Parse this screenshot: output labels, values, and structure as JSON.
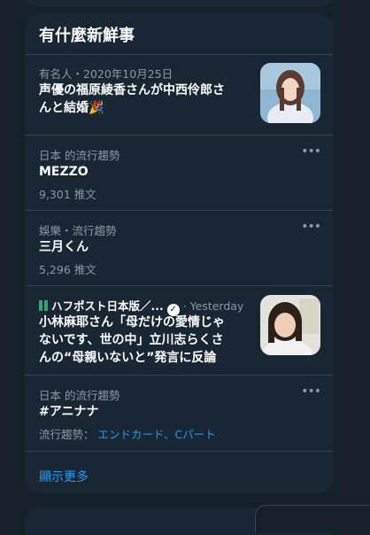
{
  "title": "有什麼新鮮事",
  "items": [
    {
      "meta": "有名人・2020年10月25日",
      "headline_1": "声優の福原綾香さんが中西伶郎さ",
      "headline_2": "んと結婚🎉"
    },
    {
      "meta": "日本 的流行趨勢",
      "headline": "MEZZO",
      "count": "9,301 推文"
    },
    {
      "meta": "娛樂・流行趨勢",
      "headline": "三月くん",
      "count": "5,296 推文"
    },
    {
      "source": "ハフポスト日本版／...",
      "time": "· Yesterday",
      "headline_1": "小林麻耶さん「母だけの愛情じゃ",
      "headline_2": "ないです、世の中」立川志らくさ",
      "headline_3": "んの“母親いないと”発言に反論"
    },
    {
      "meta": "日本 的流行趨勢",
      "headline": "#アニナナ",
      "related_label": "流行趨勢：",
      "related": "エンドカード、Cパート"
    }
  ],
  "more_label": "顯示更多",
  "more_icon": "more-horizontal-icon",
  "accent": "#1d9bf0"
}
